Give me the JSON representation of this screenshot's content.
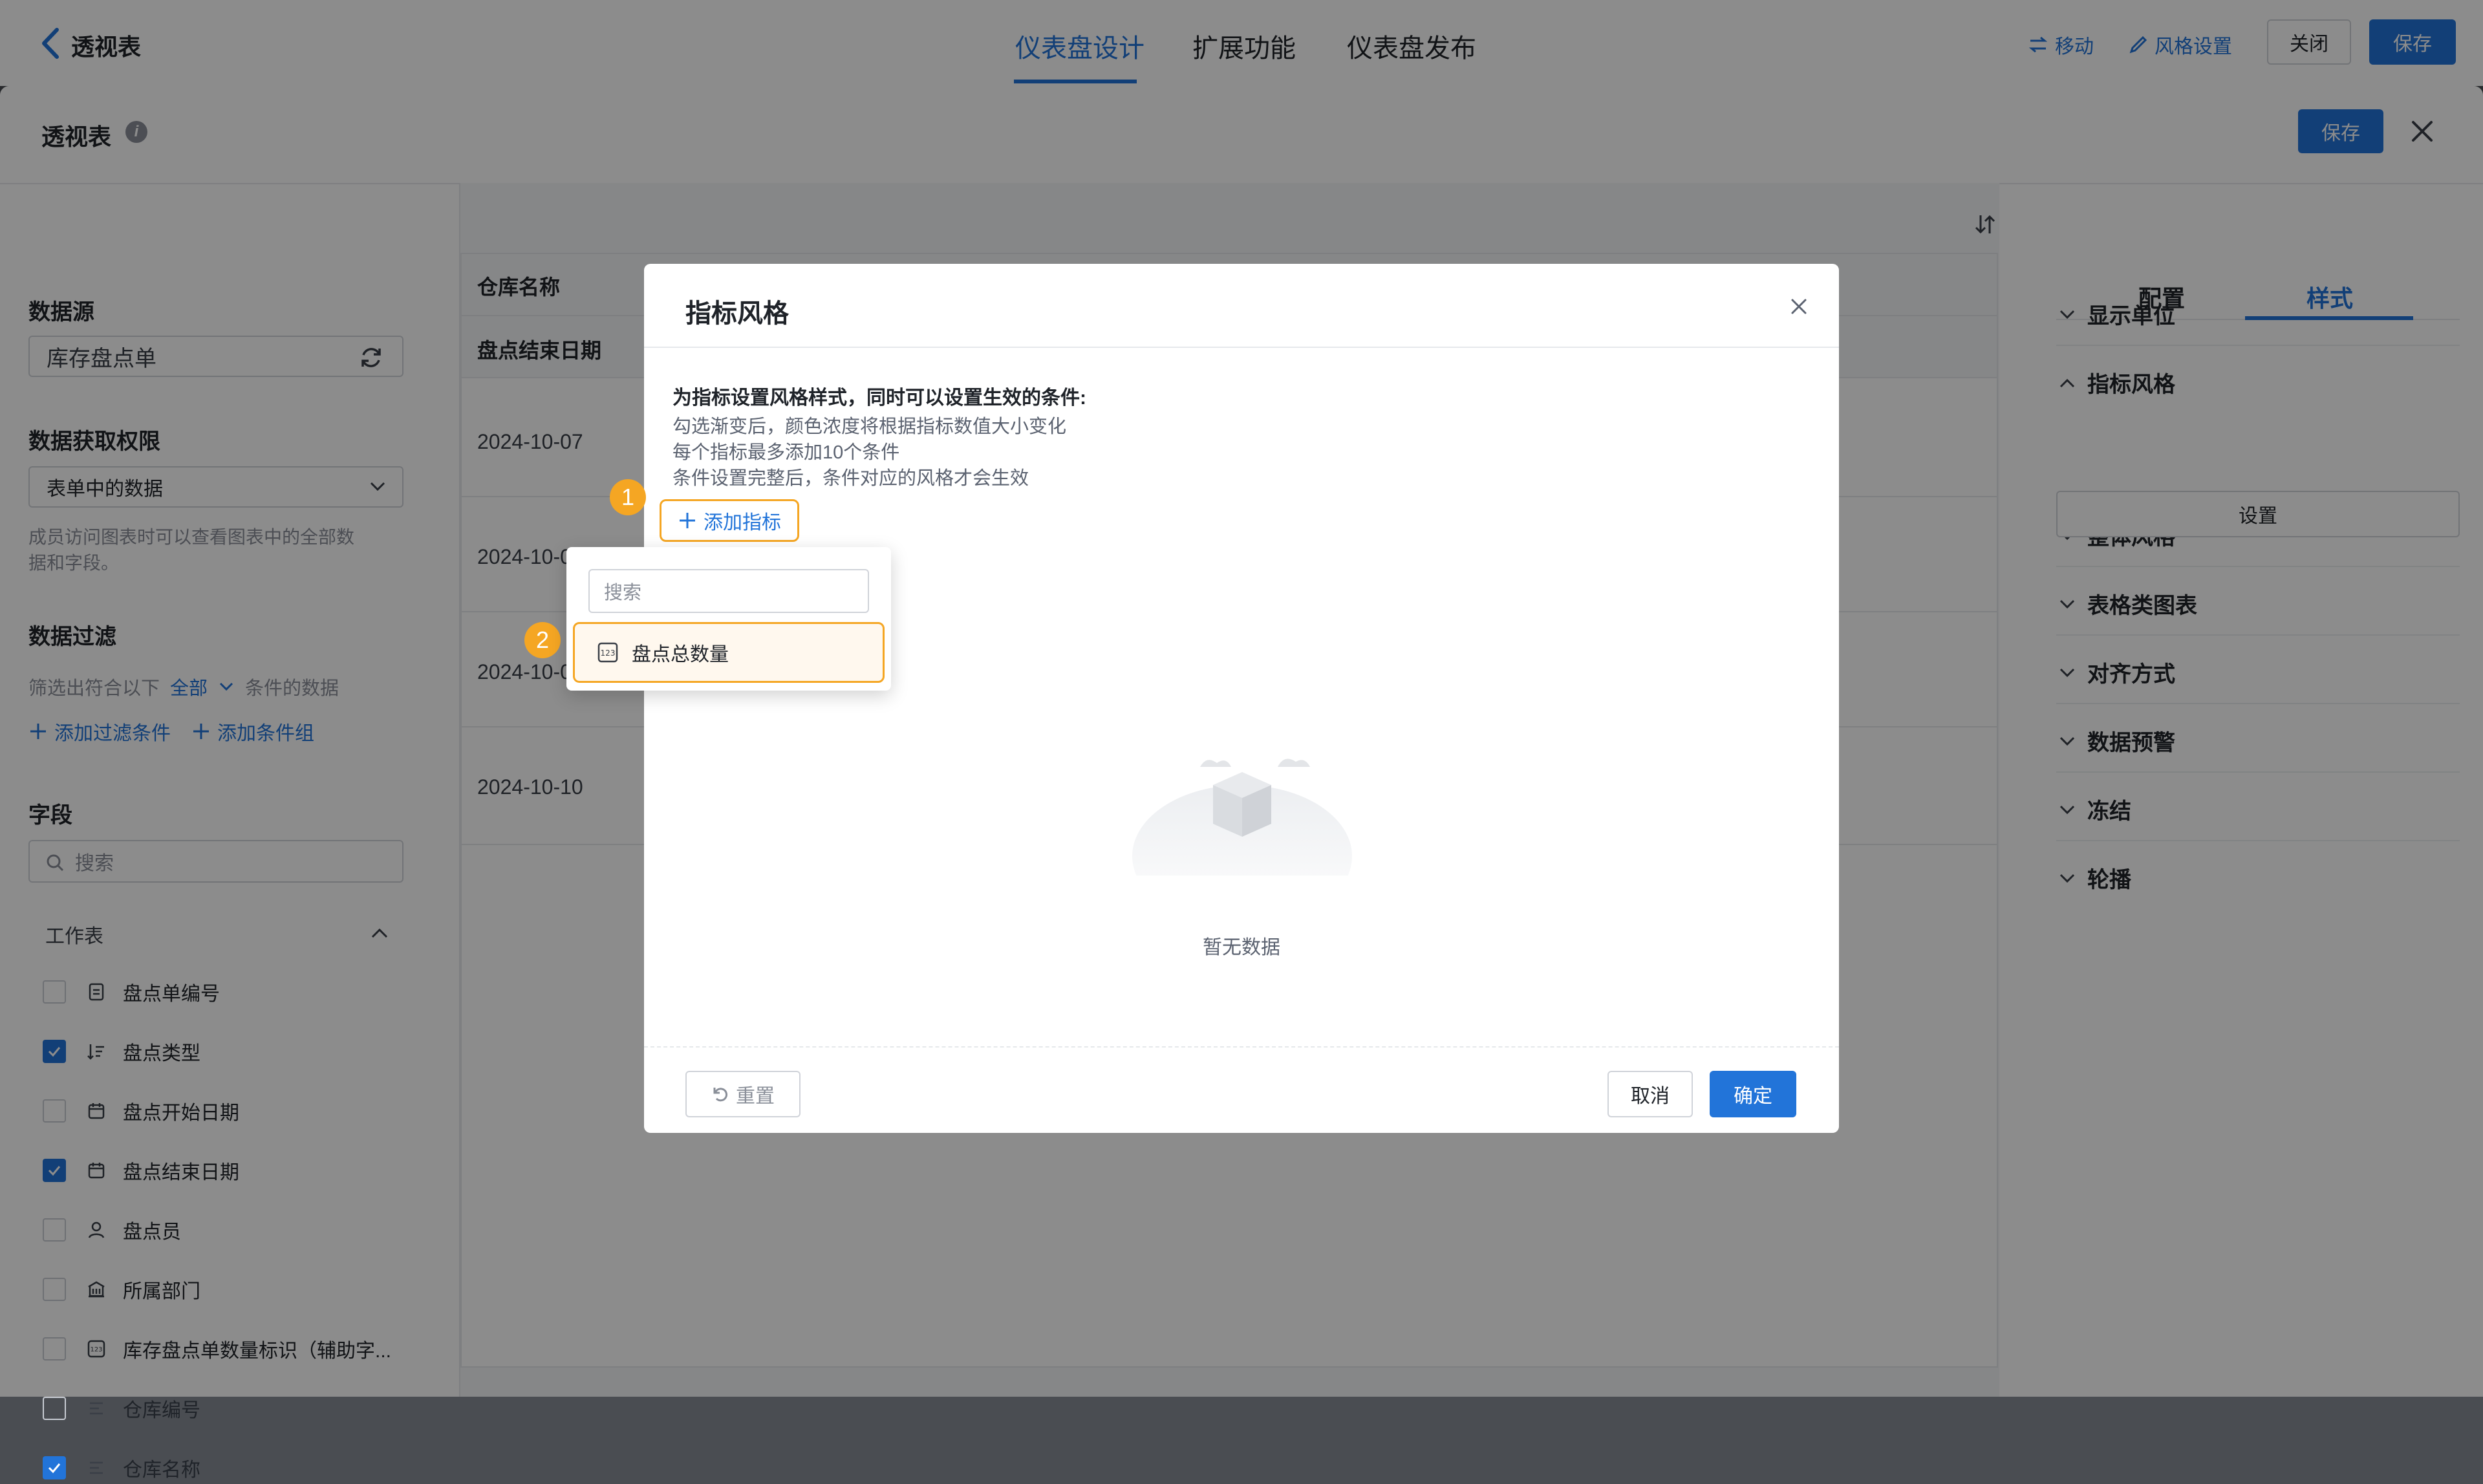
{
  "topbar": {
    "back_title": "透视表",
    "tabs": [
      "仪表盘设计",
      "扩展功能",
      "仪表盘发布"
    ],
    "move_label": "移动",
    "style_settings_label": "风格设置",
    "close_label": "关闭",
    "save_label": "保存"
  },
  "panel": {
    "title": "透视表",
    "save_label": "保存"
  },
  "left": {
    "datasource_title": "数据源",
    "datasource_value": "库存盘点单",
    "permission_title": "数据获取权限",
    "permission_value": "表单中的数据",
    "permission_hint_1": "成员访问图表时可以查看图表中的全部数",
    "permission_hint_2": "据和字段。",
    "filter_title": "数据过滤",
    "filter_prefix": "筛选出符合以下",
    "filter_scope": "全部",
    "filter_suffix": "条件的数据",
    "add_filter": "添加过滤条件",
    "add_group": "添加条件组",
    "fields_title": "字段",
    "search_placeholder": "搜索",
    "worksheet_label": "工作表",
    "fields": [
      {
        "label": "盘点单编号",
        "checked": false,
        "icon": "doc-icon"
      },
      {
        "label": "盘点类型",
        "checked": true,
        "icon": "sort-list-icon"
      },
      {
        "label": "盘点开始日期",
        "checked": false,
        "icon": "calendar-icon"
      },
      {
        "label": "盘点结束日期",
        "checked": true,
        "icon": "calendar-icon"
      },
      {
        "label": "盘点员",
        "checked": false,
        "icon": "user-icon"
      },
      {
        "label": "所属部门",
        "checked": false,
        "icon": "department-icon"
      },
      {
        "label": "库存盘点单数量标识（辅助字...",
        "checked": false,
        "icon": "number-icon"
      },
      {
        "label": "仓库编号",
        "checked": false,
        "icon": "text-lines-icon"
      },
      {
        "label": "仓库名称",
        "checked": true,
        "icon": "text-lines-icon"
      }
    ]
  },
  "table": {
    "header_1": "仓库名称",
    "header_2": "盘点结束日期",
    "rows": [
      "2024-10-07",
      "2024-10-0",
      "2024-10-0",
      "2024-10-10"
    ]
  },
  "right": {
    "tabs": [
      "配置",
      "样式"
    ],
    "sections": [
      "显示单位",
      "指标风格",
      "整体风格",
      "表格类图表",
      "对齐方式",
      "数据预警",
      "冻结",
      "轮播"
    ],
    "settings_button": "设置"
  },
  "modal": {
    "title": "指标风格",
    "heading": "为指标设置风格样式，同时可以设置生效的条件:",
    "lines": [
      "勾选渐变后，颜色浓度将根据指标数值大小变化",
      "每个指标最多添加10个条件",
      "条件设置完整后，条件对应的风格才会生效"
    ],
    "add_metric": "添加指标",
    "empty_text": "暂无数据",
    "reset": "重置",
    "cancel": "取消",
    "confirm": "确定",
    "badge_1": "1",
    "badge_2": "2"
  },
  "dropdown": {
    "search_placeholder": "搜索",
    "option": "盘点总数量"
  },
  "colors": {
    "primary": "#2274d9",
    "highlight": "#f5a623"
  }
}
